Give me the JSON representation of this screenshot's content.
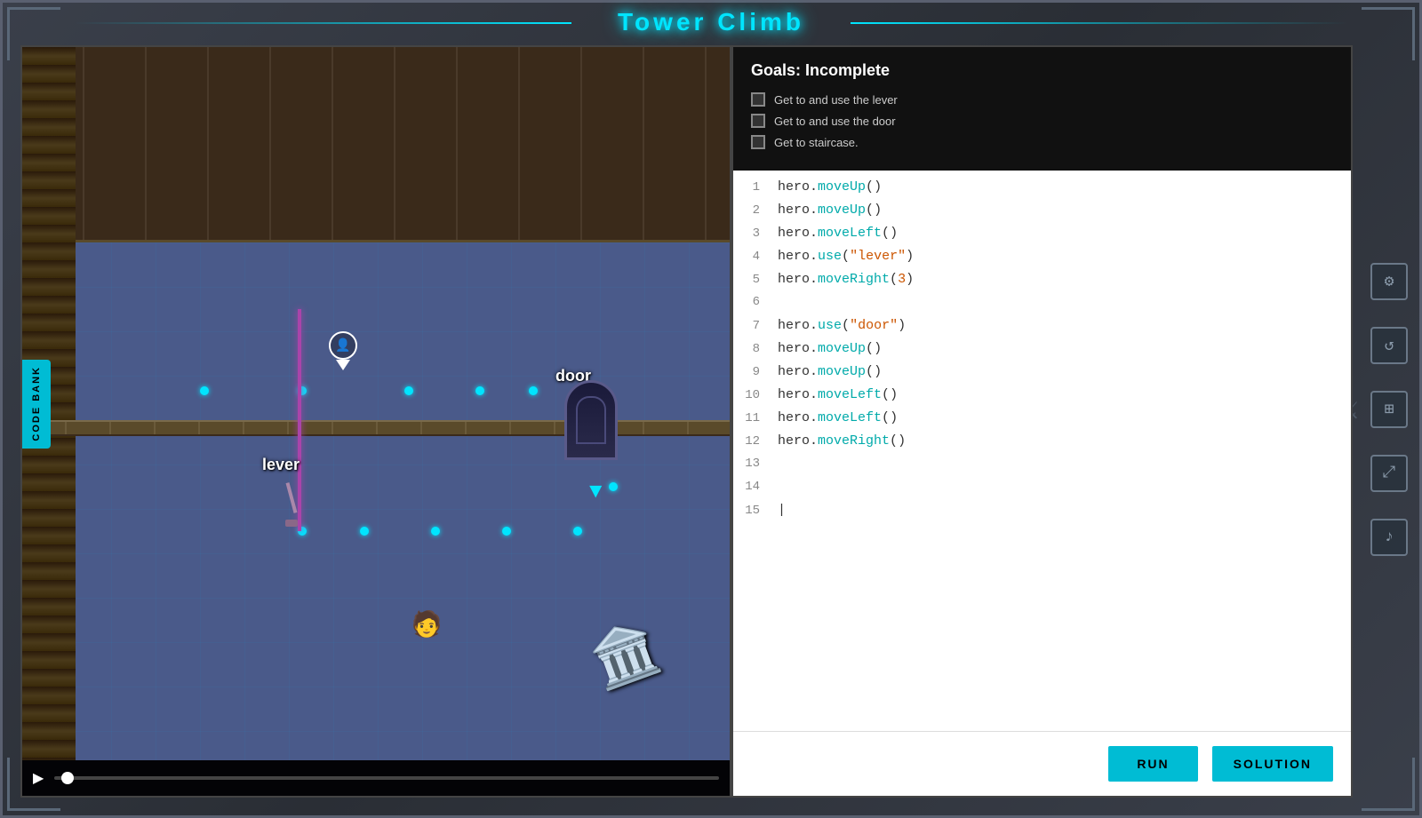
{
  "app": {
    "title": "Tower Climb"
  },
  "goals": {
    "title": "Goals: Incomplete",
    "items": [
      {
        "id": "goal-lever",
        "text": "Get to and use the lever",
        "checked": false
      },
      {
        "id": "goal-door",
        "text": "Get to and use the door",
        "checked": false
      },
      {
        "id": "goal-staircase",
        "text": "Get to staircase.",
        "checked": false
      }
    ]
  },
  "code": {
    "lines": [
      {
        "num": "1",
        "text": "hero.moveUp()"
      },
      {
        "num": "2",
        "text": "hero.moveUp()"
      },
      {
        "num": "3",
        "text": "hero.moveLeft()"
      },
      {
        "num": "4",
        "text": "hero.use(\"lever\")"
      },
      {
        "num": "5",
        "text": "hero.moveRight(3)"
      },
      {
        "num": "6",
        "text": ""
      },
      {
        "num": "7",
        "text": "hero.use(\"door\")"
      },
      {
        "num": "8",
        "text": "hero.moveUp()"
      },
      {
        "num": "9",
        "text": "hero.moveUp()"
      },
      {
        "num": "10",
        "text": "hero.moveLeft()"
      },
      {
        "num": "11",
        "text": "hero.moveLeft()"
      },
      {
        "num": "12",
        "text": "hero.moveRight()"
      },
      {
        "num": "13",
        "text": ""
      },
      {
        "num": "14",
        "text": ""
      },
      {
        "num": "15",
        "text": ""
      }
    ]
  },
  "game": {
    "lever_label": "lever",
    "door_label": "door",
    "code_bank_label": "CODE BANK"
  },
  "buttons": {
    "run": "RUN",
    "solution": "SOLUTION"
  },
  "playback": {
    "play_icon": "▶"
  },
  "sidebar_icons": [
    {
      "name": "gear-icon",
      "symbol": "⚙"
    },
    {
      "name": "refresh-icon",
      "symbol": "↺"
    },
    {
      "name": "map-icon",
      "symbol": "⊞"
    },
    {
      "name": "resize-icon",
      "symbol": "⤢"
    },
    {
      "name": "volume-icon",
      "symbol": "♪"
    }
  ]
}
